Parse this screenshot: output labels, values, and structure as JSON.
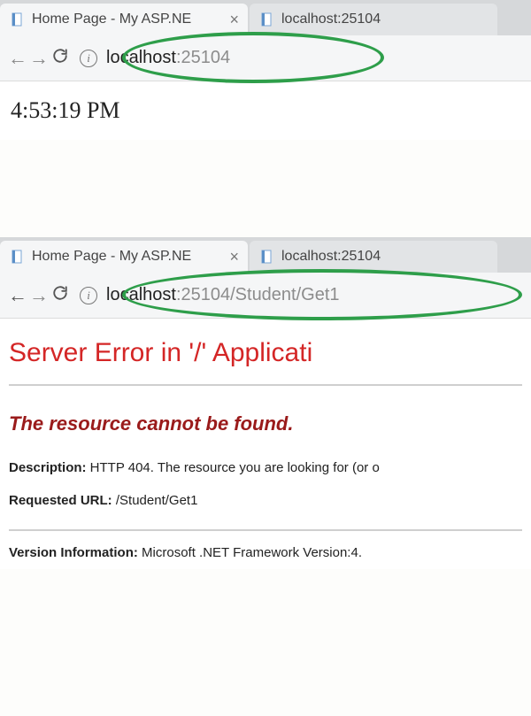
{
  "top": {
    "tabs": [
      {
        "title": "Home Page - My ASP.NE",
        "active": true
      },
      {
        "title": "localhost:25104",
        "active": false
      }
    ],
    "url_host": "localhost",
    "url_rest": ":25104",
    "content_time": "4:53:19 PM"
  },
  "bottom": {
    "tabs": [
      {
        "title": "Home Page - My ASP.NE",
        "active": true
      },
      {
        "title": "localhost:25104",
        "active": false
      }
    ],
    "url_host": "localhost",
    "url_rest": ":25104/Student/Get1",
    "error": {
      "title": "Server Error in '/' Applicati",
      "sub": "The resource cannot be found.",
      "desc_label": "Description:",
      "desc_text": " HTTP 404. The resource you are looking for (or o",
      "req_label": "Requested URL:",
      "req_text": " /Student/Get1",
      "ver_label": "Version Information:",
      "ver_text": " Microsoft .NET Framework Version:4."
    }
  }
}
